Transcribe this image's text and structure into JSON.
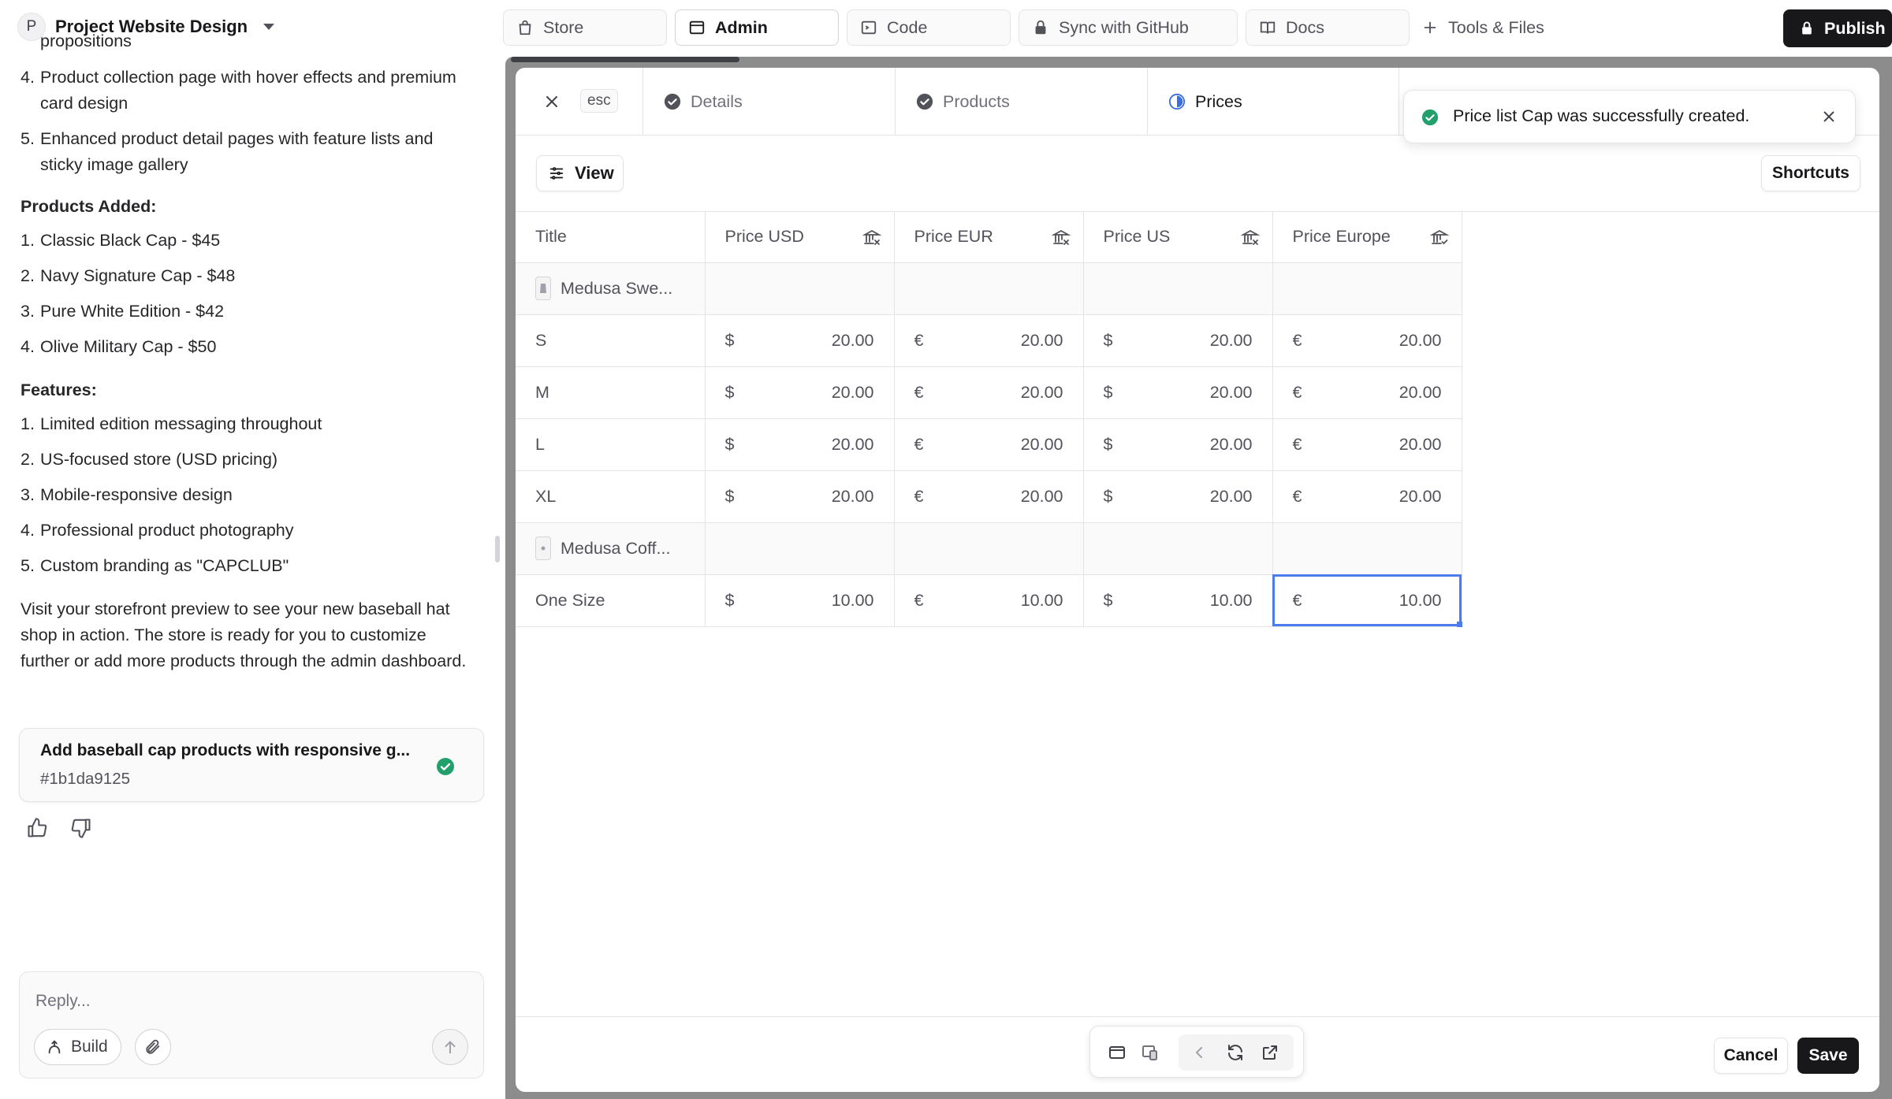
{
  "project": {
    "avatar_letter": "P",
    "name": "Project Website Design"
  },
  "chat": {
    "cut_off_text": "propositions",
    "list_a": [
      {
        "n": "4.",
        "text": "Product collection page with hover effects and premium",
        "cont": "card design"
      },
      {
        "n": "5.",
        "text": "Enhanced product detail pages with feature lists and",
        "cont": "sticky image gallery"
      }
    ],
    "products_heading": "Products Added:",
    "products": [
      {
        "n": "1.",
        "text": "Classic Black Cap - $45"
      },
      {
        "n": "2.",
        "text": "Navy Signature Cap - $48"
      },
      {
        "n": "3.",
        "text": "Pure White Edition - $42"
      },
      {
        "n": "4.",
        "text": "Olive Military Cap - $50"
      }
    ],
    "features_heading": "Features:",
    "features": [
      {
        "n": "1.",
        "text": "Limited edition messaging throughout"
      },
      {
        "n": "2.",
        "text": "US-focused store (USD pricing)"
      },
      {
        "n": "3.",
        "text": "Mobile-responsive design"
      },
      {
        "n": "4.",
        "text": "Professional product photography"
      },
      {
        "n": "5.",
        "text": "Custom branding as \"CAPCLUB\""
      }
    ],
    "closing_lines": [
      "Visit your storefront preview to see your new baseball hat",
      "shop in action. The store is ready for you to customize",
      "further or add more products through the admin dashboard."
    ],
    "commit": {
      "title": "Add baseball cap products with responsive g...",
      "hash": "#1b1da9125"
    },
    "reply_placeholder": "Reply...",
    "build_label": "Build"
  },
  "toolbar": {
    "tabs": [
      {
        "label": "Store",
        "icon": "bag-icon"
      },
      {
        "label": "Admin",
        "icon": "window-icon",
        "active": true
      },
      {
        "label": "Code",
        "icon": "terminal-icon"
      },
      {
        "label": "Sync with GitHub",
        "icon": "lock-icon"
      },
      {
        "label": "Docs",
        "icon": "book-icon"
      }
    ],
    "tools_files": "Tools & Files",
    "publish": "Publish"
  },
  "modal": {
    "esc": "esc",
    "tabs": [
      {
        "label": "Details",
        "status": "done"
      },
      {
        "label": "Products",
        "status": "done"
      },
      {
        "label": "Prices",
        "status": "in-progress"
      }
    ],
    "toast": "Price list Cap was successfully created.",
    "view_label": "View",
    "shortcuts_label": "Shortcuts",
    "grid": {
      "columns": [
        "Title",
        "Price USD",
        "Price EUR",
        "Price US",
        "Price Europe"
      ],
      "currencies": [
        "$",
        "€",
        "$",
        "€"
      ],
      "rows": [
        {
          "type": "group",
          "title": "Medusa Swe..."
        },
        {
          "type": "variant",
          "title": "S",
          "prices": [
            "20.00",
            "20.00",
            "20.00",
            "20.00"
          ]
        },
        {
          "type": "variant",
          "title": "M",
          "prices": [
            "20.00",
            "20.00",
            "20.00",
            "20.00"
          ]
        },
        {
          "type": "variant",
          "title": "L",
          "prices": [
            "20.00",
            "20.00",
            "20.00",
            "20.00"
          ]
        },
        {
          "type": "variant",
          "title": "XL",
          "prices": [
            "20.00",
            "20.00",
            "20.00",
            "20.00"
          ]
        },
        {
          "type": "group",
          "title": "Medusa Coff..."
        },
        {
          "type": "variant",
          "title": "One Size",
          "prices": [
            "10.00",
            "10.00",
            "10.00",
            "10.00"
          ],
          "selected_col": 3
        }
      ]
    },
    "cancel": "Cancel",
    "save": "Save"
  },
  "colors": {
    "accent": "#4b7bec",
    "success": "#22a06b",
    "dark": "#18181b",
    "frame": "#8c8c8c"
  }
}
